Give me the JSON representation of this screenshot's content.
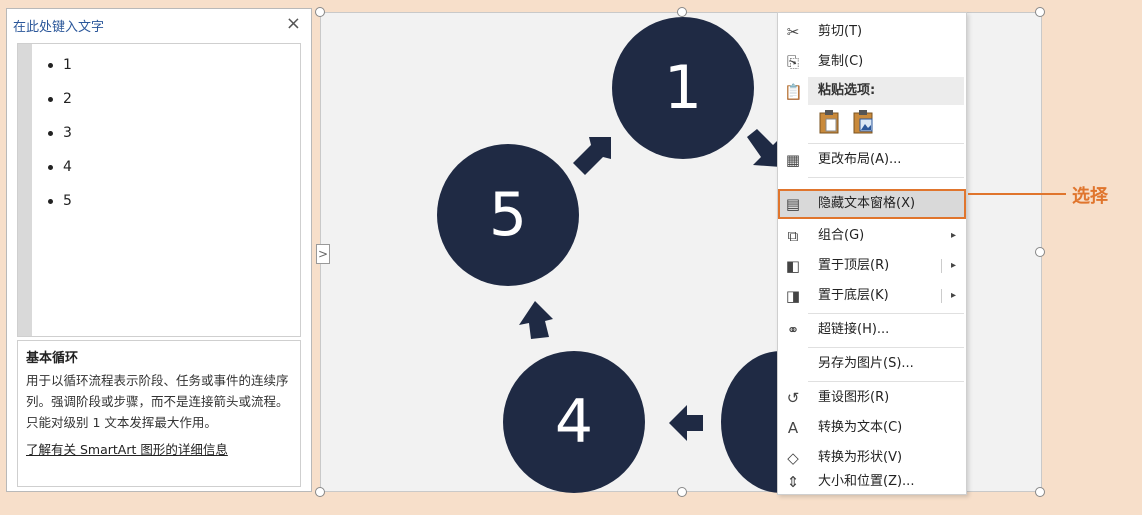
{
  "text_pane": {
    "title": "在此处键入文字",
    "close": "×",
    "bullets": [
      "1",
      "2",
      "3",
      "4",
      "5"
    ],
    "description_title": "基本循环",
    "description_body": "用于以循环流程表示阶段、任务或事件的连续序列。强调阶段或步骤，而不是连接箭头或流程。只能对级别 1 文本发挥最大作用。",
    "learn_more": "了解有关 SmartArt 图形的详细信息"
  },
  "diagram": {
    "expand_arrow": ">",
    "circles": [
      "1",
      "5",
      "4"
    ],
    "circle_color": "#1f2a44"
  },
  "context_menu": {
    "items": [
      {
        "icon": "scissors-icon",
        "glyph": "✂",
        "label": "剪切(T)"
      },
      {
        "icon": "copy-icon",
        "glyph": "⎘",
        "label": "复制(C)"
      },
      {
        "icon": "layout-icon",
        "glyph": "▦",
        "label": "更改布局(A)..."
      },
      {
        "icon": "text-pane-icon",
        "glyph": "▤",
        "label": "隐藏文本窗格(X)"
      },
      {
        "icon": "group-icon",
        "glyph": "⧉",
        "label": "组合(G)"
      },
      {
        "icon": "bring-front-icon",
        "glyph": "◧",
        "label": "置于顶层(R)"
      },
      {
        "icon": "send-back-icon",
        "glyph": "◨",
        "label": "置于底层(K)"
      },
      {
        "icon": "hyperlink-icon",
        "glyph": "⚭",
        "label": "超链接(H)..."
      },
      {
        "icon": "",
        "glyph": "",
        "label": "另存为图片(S)..."
      },
      {
        "icon": "reset-icon",
        "glyph": "↺",
        "label": "重设图形(R)"
      },
      {
        "icon": "convert-text-icon",
        "glyph": "A",
        "label": "转换为文本(C)"
      },
      {
        "icon": "convert-shape-icon",
        "glyph": "◇",
        "label": "转换为形状(V)"
      },
      {
        "icon": "size-position-icon",
        "glyph": "⇕",
        "label": "大小和位置(Z)..."
      }
    ],
    "paste_header": "粘贴选项:",
    "submenu_arrow": "▸"
  },
  "annotation": {
    "label": "选择",
    "color": "#e0752d"
  }
}
